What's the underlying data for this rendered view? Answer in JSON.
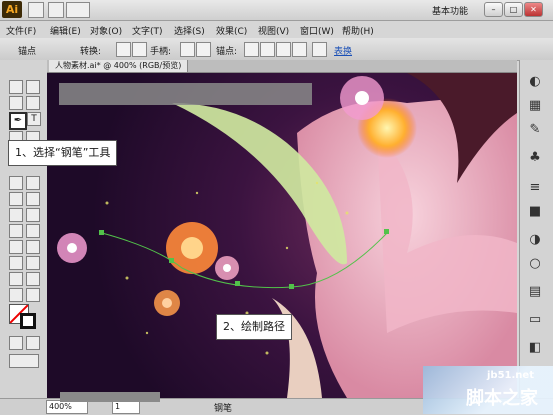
{
  "app": {
    "logo": "Ai",
    "workspace": "基本功能"
  },
  "menu": {
    "items": [
      "文件(F)",
      "编辑(E)",
      "对象(O)",
      "文字(T)",
      "选择(S)",
      "效果(C)",
      "视图(V)",
      "窗口(W)",
      "帮助(H)"
    ]
  },
  "control_bar": {
    "anchor_label": "锚点",
    "convert_label": "转换:",
    "handles_label": "手柄:",
    "anchor2_label": "锚点:",
    "convert_link": "表换"
  },
  "document": {
    "tab_title": "人物素材.ai* @ 400% (RGB/预览)"
  },
  "callouts": {
    "step1": "1、选择“钢笔”工具",
    "step2": "2、绘制路径"
  },
  "status": {
    "zoom": "400%",
    "page": "1",
    "tool_name": "钢笔"
  },
  "watermark": {
    "site": "jb51.net",
    "name": "脚本之家"
  },
  "colors": {
    "pen_path": "#52c24a",
    "accent_leaf": "#cfe8a0"
  }
}
